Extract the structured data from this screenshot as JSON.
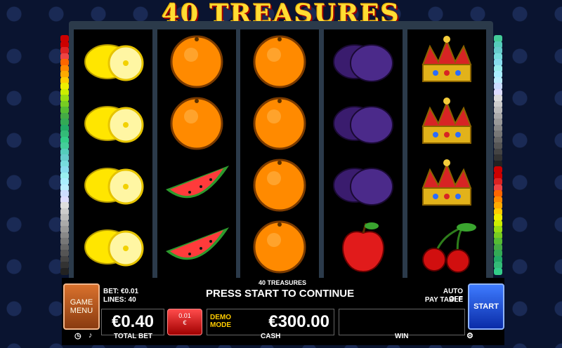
{
  "game": {
    "title": "40 TREASURES",
    "subtitle": "40 TREASURES",
    "message": "PRESS START TO CONTINUE"
  },
  "bet": {
    "bet_label": "BET: €0.01",
    "lines_label": "LINES: 40",
    "total_bet_value": "€0.40",
    "total_bet_label": "TOTAL BET",
    "coin_top": "0.01",
    "coin_bottom": "€"
  },
  "cash": {
    "mode_line1": "DEMO",
    "mode_line2": "MODE",
    "value": "€300.00",
    "label": "CASH"
  },
  "win": {
    "value": "",
    "label": "WIN"
  },
  "buttons": {
    "menu_line1": "GAME",
    "menu_line2": "MENU",
    "start": "START",
    "auto": "AUTO OFF",
    "paytable": "PAY TABLE"
  },
  "reels": [
    [
      "lemon",
      "lemon",
      "lemon",
      "lemon"
    ],
    [
      "orange",
      "orange",
      "watermelon",
      "watermelon"
    ],
    [
      "orange",
      "orange",
      "orange",
      "orange"
    ],
    [
      "plum",
      "plum",
      "plum",
      "apple"
    ],
    [
      "crown",
      "crown",
      "crown",
      "cherries"
    ]
  ]
}
